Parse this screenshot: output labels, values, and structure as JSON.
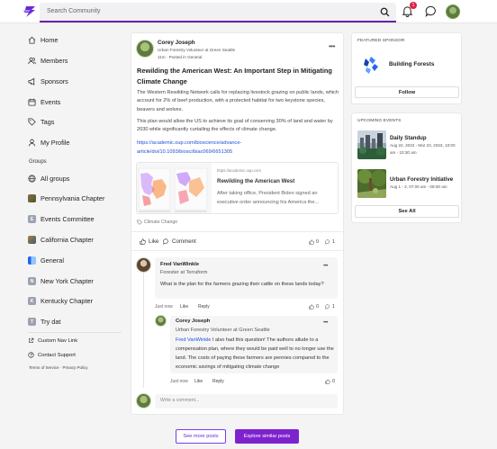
{
  "header": {
    "search_placeholder": "Search Community",
    "notification_count": "1"
  },
  "colors": {
    "accent": "#7e22ce",
    "link": "#1d4ed8",
    "badge": "#e11d48"
  },
  "nav": {
    "items": [
      {
        "label": "Home",
        "icon": "home-icon"
      },
      {
        "label": "Members",
        "icon": "members-icon"
      },
      {
        "label": "Sponsors",
        "icon": "megaphone-icon"
      },
      {
        "label": "Events",
        "icon": "calendar-icon"
      },
      {
        "label": "Tags",
        "icon": "tag-icon"
      },
      {
        "label": "My Profile",
        "icon": "user-icon"
      }
    ],
    "groups_heading": "Groups",
    "groups": [
      {
        "label": "All groups"
      },
      {
        "label": "Pennsylvania Chapter"
      },
      {
        "label": "Events Committee",
        "letter": "E"
      },
      {
        "label": "California Chapter"
      },
      {
        "label": "General"
      },
      {
        "label": "New York Chapter",
        "letter": "N"
      },
      {
        "label": "Kentucky Chapter",
        "letter": "K"
      },
      {
        "label": "Try dat",
        "letter": "T"
      }
    ],
    "custom_link": "Custom Nav Link",
    "support": "Contact Support",
    "footer": "Terms of Service · Privacy Policy"
  },
  "post": {
    "author": "Corey Joseph",
    "role": "Urban Forestry Volunteer at Green Seattle",
    "meta": "11m · Posted in General",
    "title": "Rewilding the American West: An Important Step in Mitigating Climate Change",
    "body1": "The Western Rewilding Network calls for replacing livestock grazing on public lands, which account for 2% of beef production, with a protected habitat for two keystone species, beavers and wolves.",
    "body2": "This plan would allow the US to achieve its goal of conserving 30% of land and water by 2030 while significantly curtailing the effects of climate change.",
    "link": "https://academic.oup.com/bioscience/advance-article/doi/10.1093/biosci/biac069/6651305",
    "preview": {
      "domain": "https://academic.oup.com",
      "title": "Rewilding the American West",
      "desc": "After taking office, President Biden signed an executive order announcing his America the..."
    },
    "tag": "Climate Change",
    "like_label": "Like",
    "comment_label": "Comment",
    "likes": "0",
    "comments": "1"
  },
  "comment": {
    "author": "Fred VanWinkle",
    "role": "Forester at Terraform",
    "text": "What is the plan for the farmers grazing their cattle on these lands today?",
    "time": "Just now",
    "like": "Like",
    "reply": "Reply",
    "likes": "0",
    "replies": "1"
  },
  "reply": {
    "author": "Corey Joseph",
    "role": "Urban Forestry Volunteer at Green Seattle",
    "mention": "Fred VanWinkle",
    "text": " I also had this question! The authors allude to a compensation plan, where they would be paid well to no longer use the land. The costs of paying these farmers are pennies compared to the economic savings of mitigating climate change",
    "time": "Just now",
    "like": "Like",
    "reply": "Reply",
    "likes": "0"
  },
  "write_placeholder": "Write a comment...",
  "buttons": {
    "see_more": "See more posts",
    "explore": "Explore similar posts"
  },
  "sponsor": {
    "heading": "FEATURED SPONSOR",
    "name": "Building Forests",
    "follow": "Follow"
  },
  "events": {
    "heading": "UPCOMING EVENTS",
    "items": [
      {
        "title": "Daily Standup",
        "date": "Aug 22, 2022 - Mar 23, 2023, 10:00 am - 10:30 am"
      },
      {
        "title": "Urban Forestry Initiative",
        "date": "Aug 1 - 2, 07:00 am - 08:00 am"
      }
    ],
    "see_all": "See All"
  }
}
